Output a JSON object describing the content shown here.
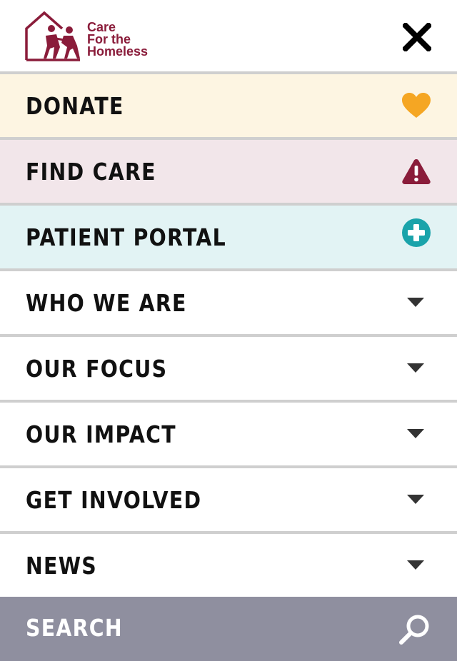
{
  "header": {
    "logo_lines": [
      "Care",
      "For the",
      "Homeless"
    ],
    "logo_icon": "house-with-people-icon",
    "close_icon": "close-icon"
  },
  "menu": {
    "items": [
      {
        "label": "DONATE",
        "icon": "heart-icon",
        "bg": "#fdf5e2",
        "icon_color": "#f5a623"
      },
      {
        "label": "FIND CARE",
        "icon": "warning-icon",
        "bg": "#f2e6ea",
        "icon_color": "#8a1c3a"
      },
      {
        "label": "PATIENT PORTAL",
        "icon": "plus-circle-icon",
        "bg": "#e2f3f4",
        "icon_color": "#1aa3aa"
      },
      {
        "label": "WHO WE ARE",
        "icon": "chevron-down-icon"
      },
      {
        "label": "OUR FOCUS",
        "icon": "chevron-down-icon"
      },
      {
        "label": "OUR IMPACT",
        "icon": "chevron-down-icon"
      },
      {
        "label": "GET INVOLVED",
        "icon": "chevron-down-icon"
      },
      {
        "label": "NEWS",
        "icon": "chevron-down-icon"
      }
    ]
  },
  "search": {
    "label": "SEARCH",
    "icon": "search-icon",
    "bg": "#8f8f9f"
  },
  "colors": {
    "brand": "#8a1c3a",
    "divider": "#cfcfcf",
    "text": "#111111"
  }
}
